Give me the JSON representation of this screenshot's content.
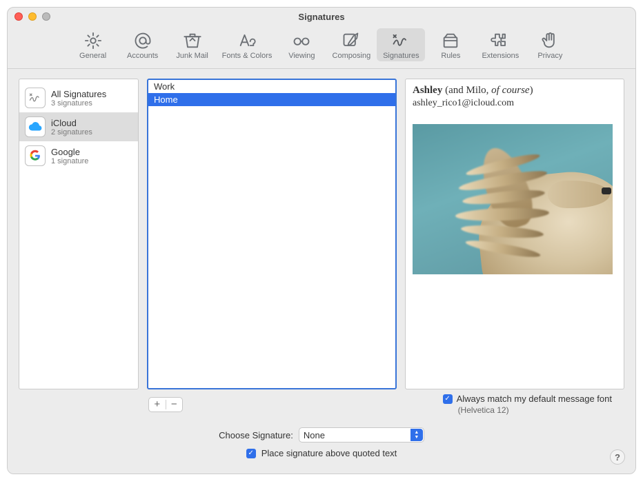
{
  "window": {
    "title": "Signatures"
  },
  "toolbar": [
    {
      "id": "general",
      "label": "General",
      "icon": "gear-icon"
    },
    {
      "id": "accounts",
      "label": "Accounts",
      "icon": "at-icon"
    },
    {
      "id": "junk",
      "label": "Junk Mail",
      "icon": "bin-icon"
    },
    {
      "id": "fonts",
      "label": "Fonts & Colors",
      "icon": "fonts-icon"
    },
    {
      "id": "viewing",
      "label": "Viewing",
      "icon": "glasses-icon"
    },
    {
      "id": "composing",
      "label": "Composing",
      "icon": "compose-icon"
    },
    {
      "id": "signatures",
      "label": "Signatures",
      "icon": "signature-icon",
      "selected": true
    },
    {
      "id": "rules",
      "label": "Rules",
      "icon": "rules-icon"
    },
    {
      "id": "extensions",
      "label": "Extensions",
      "icon": "puzzle-icon"
    },
    {
      "id": "privacy",
      "label": "Privacy",
      "icon": "hand-icon"
    }
  ],
  "accounts": [
    {
      "name": "All Signatures",
      "sub": "3 signatures",
      "icon": "signature"
    },
    {
      "name": "iCloud",
      "sub": "2 signatures",
      "icon": "cloud",
      "selected": true
    },
    {
      "name": "Google",
      "sub": "1 signature",
      "icon": "google"
    }
  ],
  "signatures": [
    {
      "name": "Work"
    },
    {
      "name": "Home",
      "selected": true
    }
  ],
  "preview": {
    "name_bold": "Ashley",
    "name_rest": " (and Milo, ",
    "name_italic": "of course",
    "name_tail": ")",
    "email": "ashley_rico1@icloud.com"
  },
  "controls": {
    "add": "+",
    "remove": "−",
    "match_font_label": "Always match my default message font",
    "match_font_checked": true,
    "font_note": "(Helvetica 12)",
    "choose_label": "Choose Signature:",
    "choose_value": "None",
    "above_quoted_label": "Place signature above quoted text",
    "above_quoted_checked": true
  }
}
